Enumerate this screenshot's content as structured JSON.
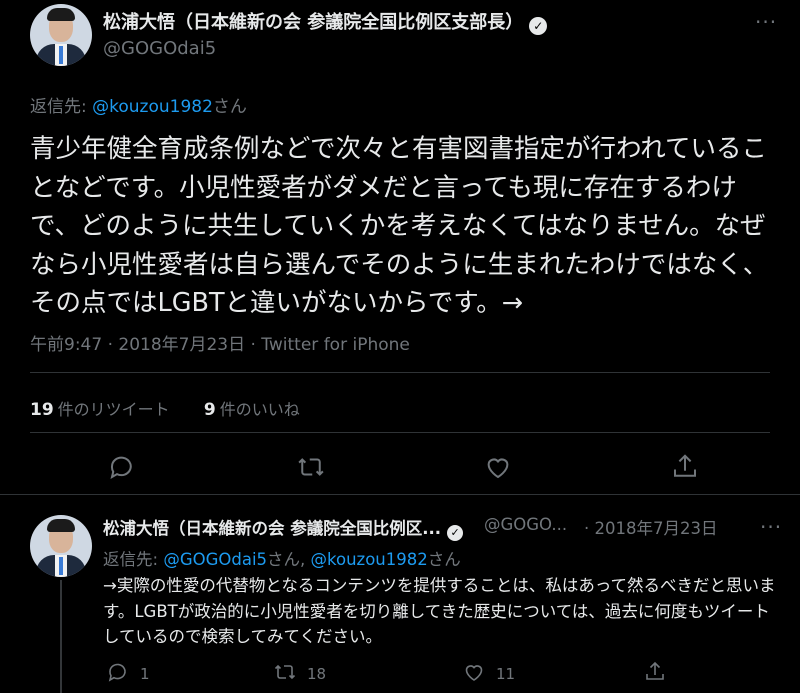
{
  "main_tweet": {
    "author_name": "松浦大悟（日本維新の会 参議院全国比例区支部長）",
    "handle": "@GOGOdai5",
    "replying_to_label": "返信先: ",
    "replying_to_handle": "@kouzou1982",
    "replying_to_suffix": "さん",
    "body": "青少年健全育成条例などで次々と有害図書指定が行われていることなどです。小児性愛者がダメだと言っても現に存在するわけで、どのように共生していくかを考えなくてはなりません。なぜなら小児性愛者は自ら選んでそのように生まれたわけではなく、その点ではLGBTと違いがないからです。→",
    "meta": "午前9:47 · 2018年7月23日 · Twitter for iPhone",
    "retweets_count": "19",
    "retweets_label": "件のリツイート",
    "likes_count": "9",
    "likes_label": "件のいいね"
  },
  "reply_tweet": {
    "author_name": "松浦大悟（日本維新の会 参議院全国比例区...",
    "handle": "@GOGO...",
    "date": "· 2018年7月23日",
    "replying_to_label": "返信先: ",
    "replying_to_handle_1": "@GOGOdai5",
    "replying_to_mid": "さん, ",
    "replying_to_handle_2": "@kouzou1982",
    "replying_to_suffix": "さん",
    "body": "→実際の性愛の代替物となるコンテンツを提供することは、私はあって然るべきだと思います。LGBTが政治的に小児性愛者を切り離してきた歴史については、過去に何度もツイートしているので検索してみてください。",
    "reply_count": "1",
    "retweet_count": "18",
    "like_count": "11"
  },
  "icons": {
    "verified": "verified-badge-icon",
    "more": "more-icon",
    "reply": "reply-icon",
    "retweet": "retweet-icon",
    "like": "heart-icon",
    "share": "share-icon"
  },
  "colors": {
    "background": "#000000",
    "text": "#e7e9ea",
    "muted": "#71767b",
    "link": "#1d9bf0",
    "divider": "#2f3336"
  }
}
